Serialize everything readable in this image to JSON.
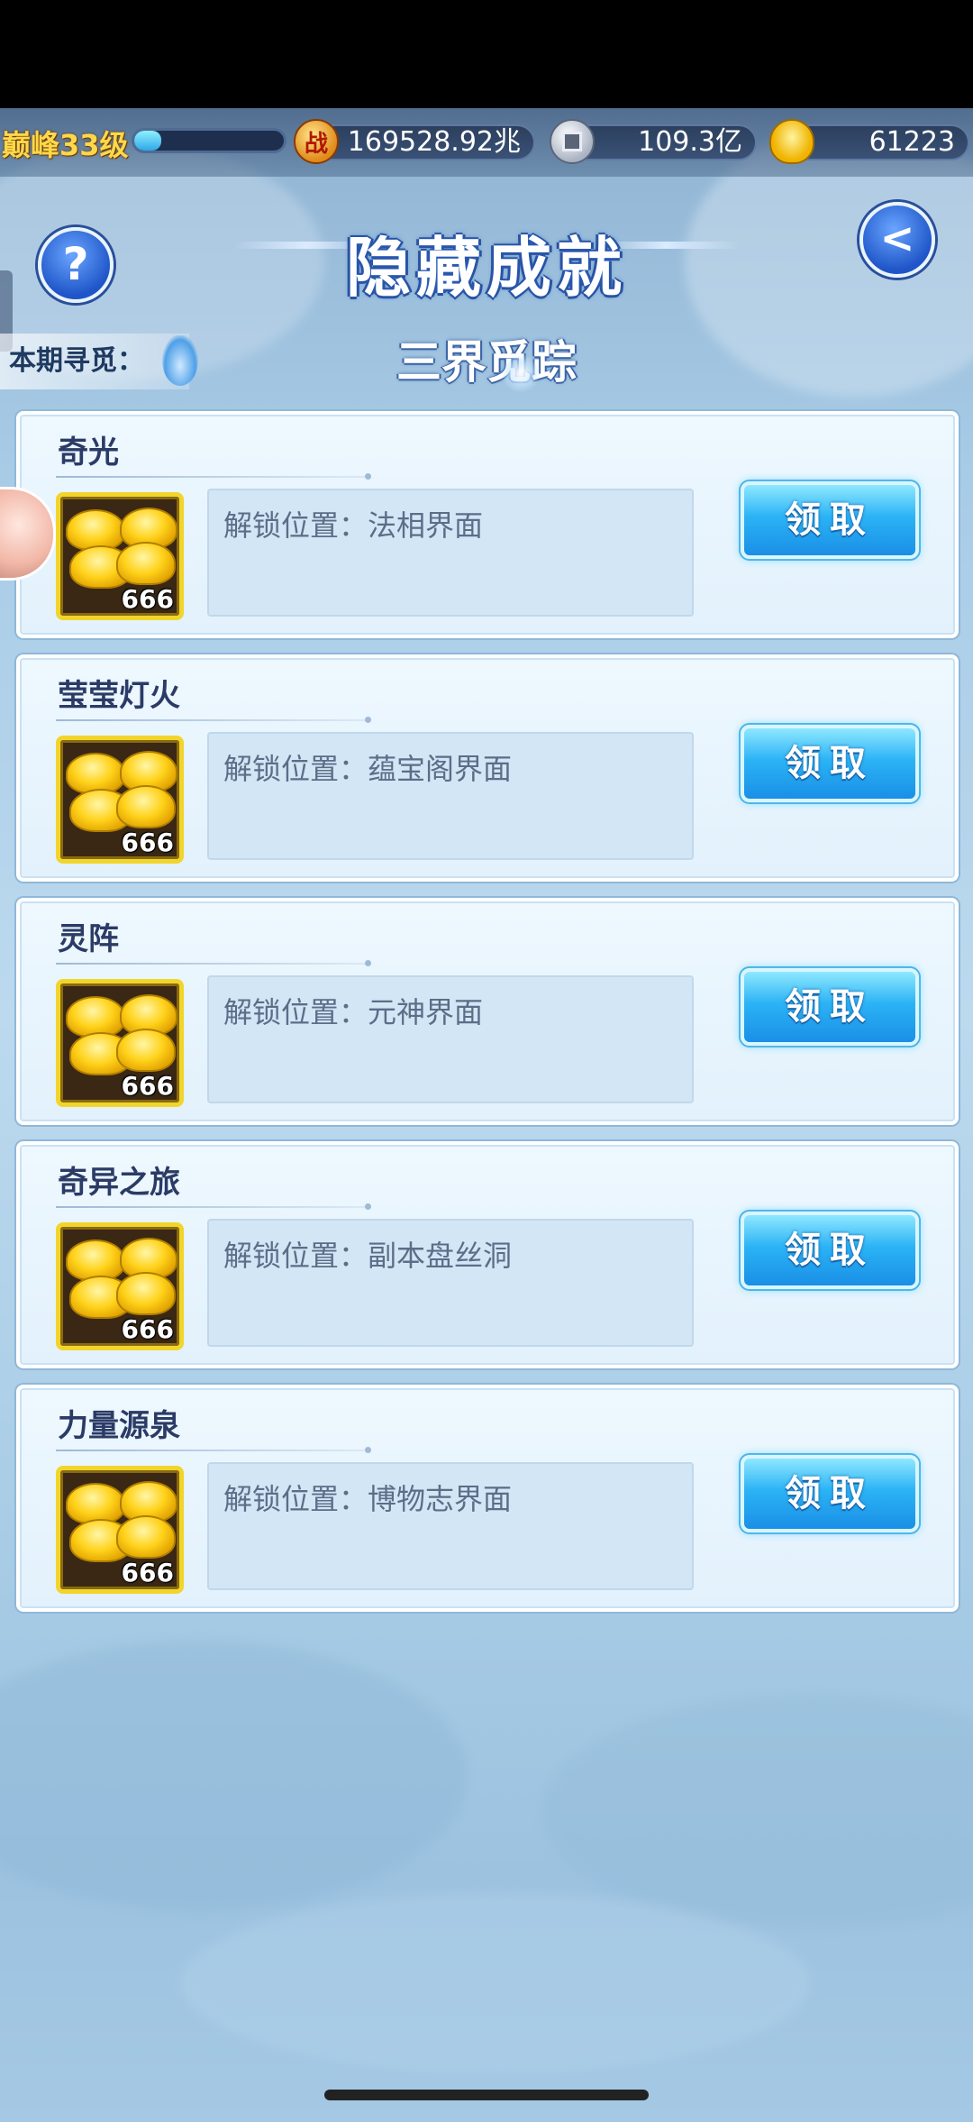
{
  "header": {
    "level_label": "巅峰33级",
    "exp_progress": 0.18,
    "battle_icon_glyph": "战",
    "battle_power": "169528.92兆",
    "silver": "109.3亿",
    "gold": "61223"
  },
  "page": {
    "title": "隐藏成就",
    "period_label": "本期寻觅：",
    "period_name": "三界觅踪",
    "help_glyph": "?",
    "back_glyph": "<"
  },
  "achievements": [
    {
      "title": "奇光",
      "reward_count": "666",
      "desc": "解锁位置：法相界面",
      "button": "领取"
    },
    {
      "title": "莹莹灯火",
      "reward_count": "666",
      "desc": "解锁位置：蕴宝阁界面",
      "button": "领取"
    },
    {
      "title": "灵阵",
      "reward_count": "666",
      "desc": "解锁位置：元神界面",
      "button": "领取"
    },
    {
      "title": "奇异之旅",
      "reward_count": "666",
      "desc": "解锁位置：副本盘丝洞",
      "button": "领取"
    },
    {
      "title": "力量源泉",
      "reward_count": "666",
      "desc": "解锁位置：博物志界面",
      "button": "领取"
    }
  ],
  "icons": {
    "battle": "battle-power-icon",
    "silver": "silver-coin-icon",
    "gold": "gold-ingot-icon",
    "help": "help-icon",
    "back": "back-arrow-icon",
    "spirit": "spirit-flame-icon",
    "reward": "gold-ingot-reward-icon"
  },
  "colors": {
    "level_text": "#ffd84a",
    "title_text": "#ffffff",
    "card_bg": "#eef8ff",
    "button": "#2bb3f5",
    "reward_frame": "#f2d52a"
  }
}
